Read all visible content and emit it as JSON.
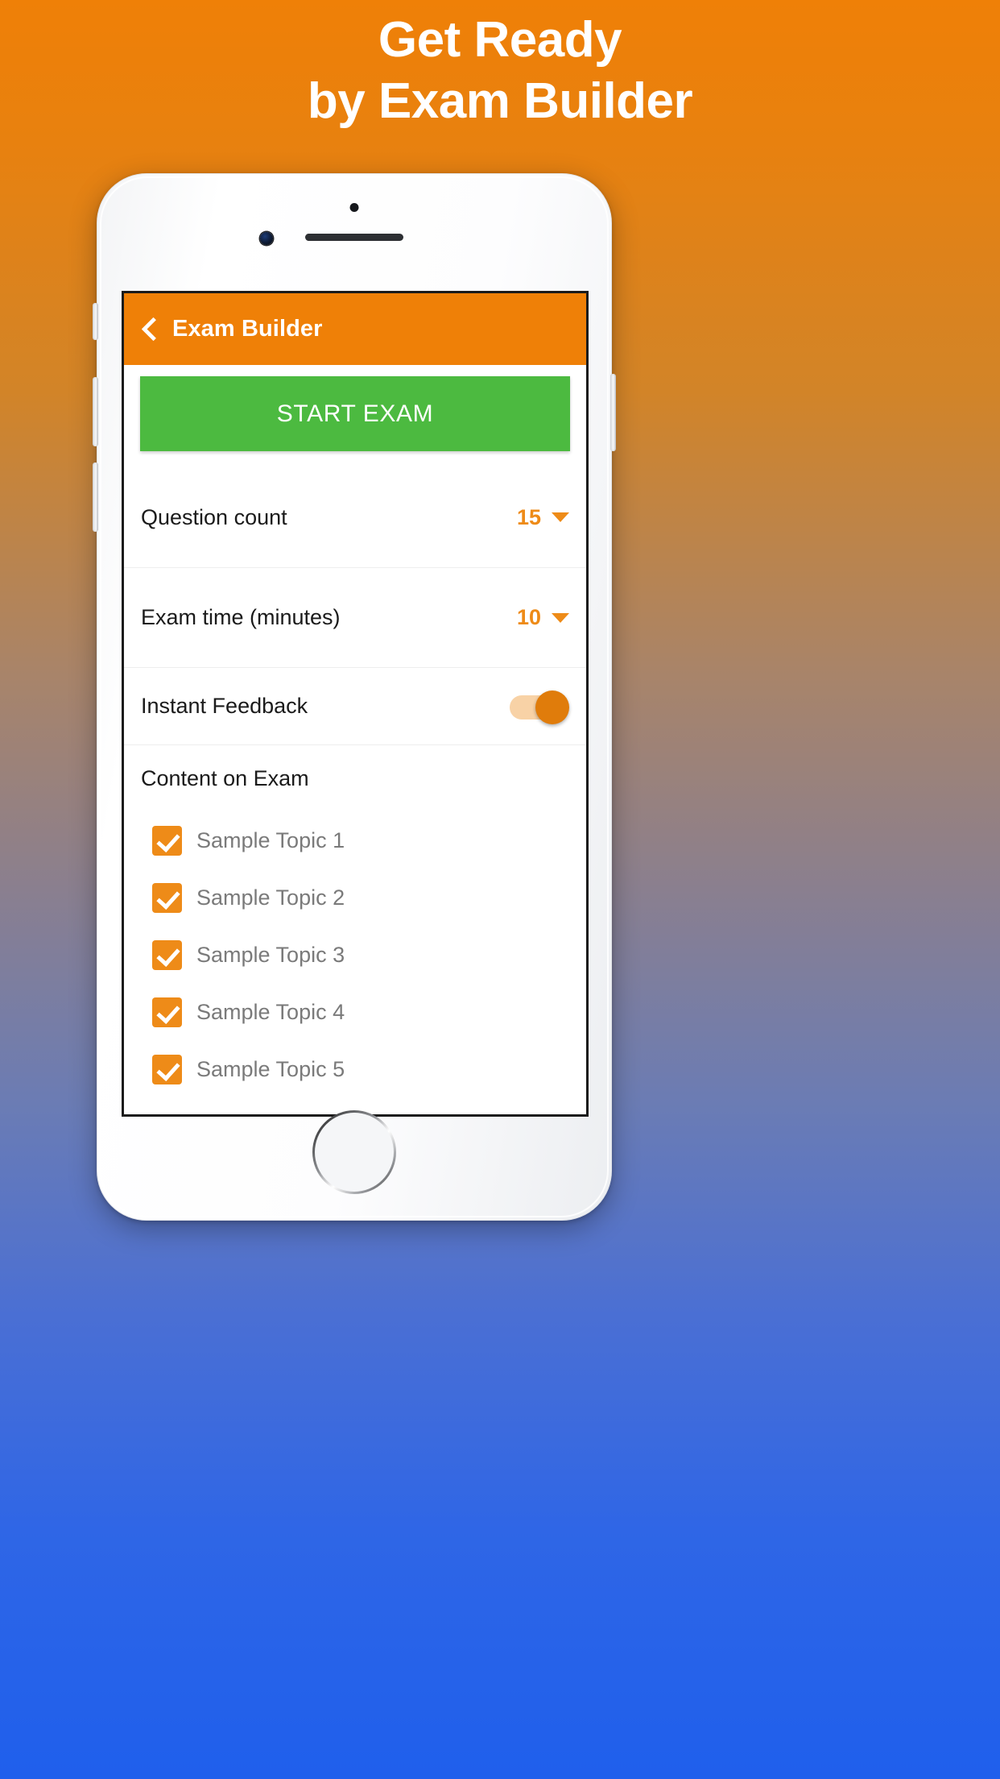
{
  "headline": {
    "line1": "Get Ready",
    "line2": "by Exam Builder"
  },
  "colors": {
    "brand_orange": "#ef8007",
    "accent_orange": "#ee8b18",
    "start_green": "#4cba40",
    "gradient_bottom_blue": "#1f5fec",
    "topic_text_gray": "#7a7a7a"
  },
  "app": {
    "appbar": {
      "back_icon": "chevron-left-icon",
      "title": "Exam Builder"
    },
    "start_button": {
      "label": "START EXAM"
    },
    "settings": [
      {
        "label": "Question count",
        "value": "15",
        "control": "dropdown",
        "caret_icon": "caret-down-icon"
      },
      {
        "label": "Exam time (minutes)",
        "value": "10",
        "control": "dropdown",
        "caret_icon": "caret-down-icon"
      }
    ],
    "toggle": {
      "label": "Instant Feedback",
      "state": "on"
    },
    "content_section": {
      "title": "Content on Exam",
      "topics": [
        {
          "label": "Sample Topic 1",
          "checked": true
        },
        {
          "label": "Sample Topic 2",
          "checked": true
        },
        {
          "label": "Sample Topic 3",
          "checked": true
        },
        {
          "label": "Sample Topic 4",
          "checked": true
        },
        {
          "label": "Sample Topic 5",
          "checked": true
        }
      ]
    }
  },
  "device": {
    "speaker_icon": "speaker-grille-icon",
    "camera_icon": "front-camera-icon",
    "sensor_icon": "proximity-sensor-icon",
    "home_button_icon": "home-button-icon"
  }
}
